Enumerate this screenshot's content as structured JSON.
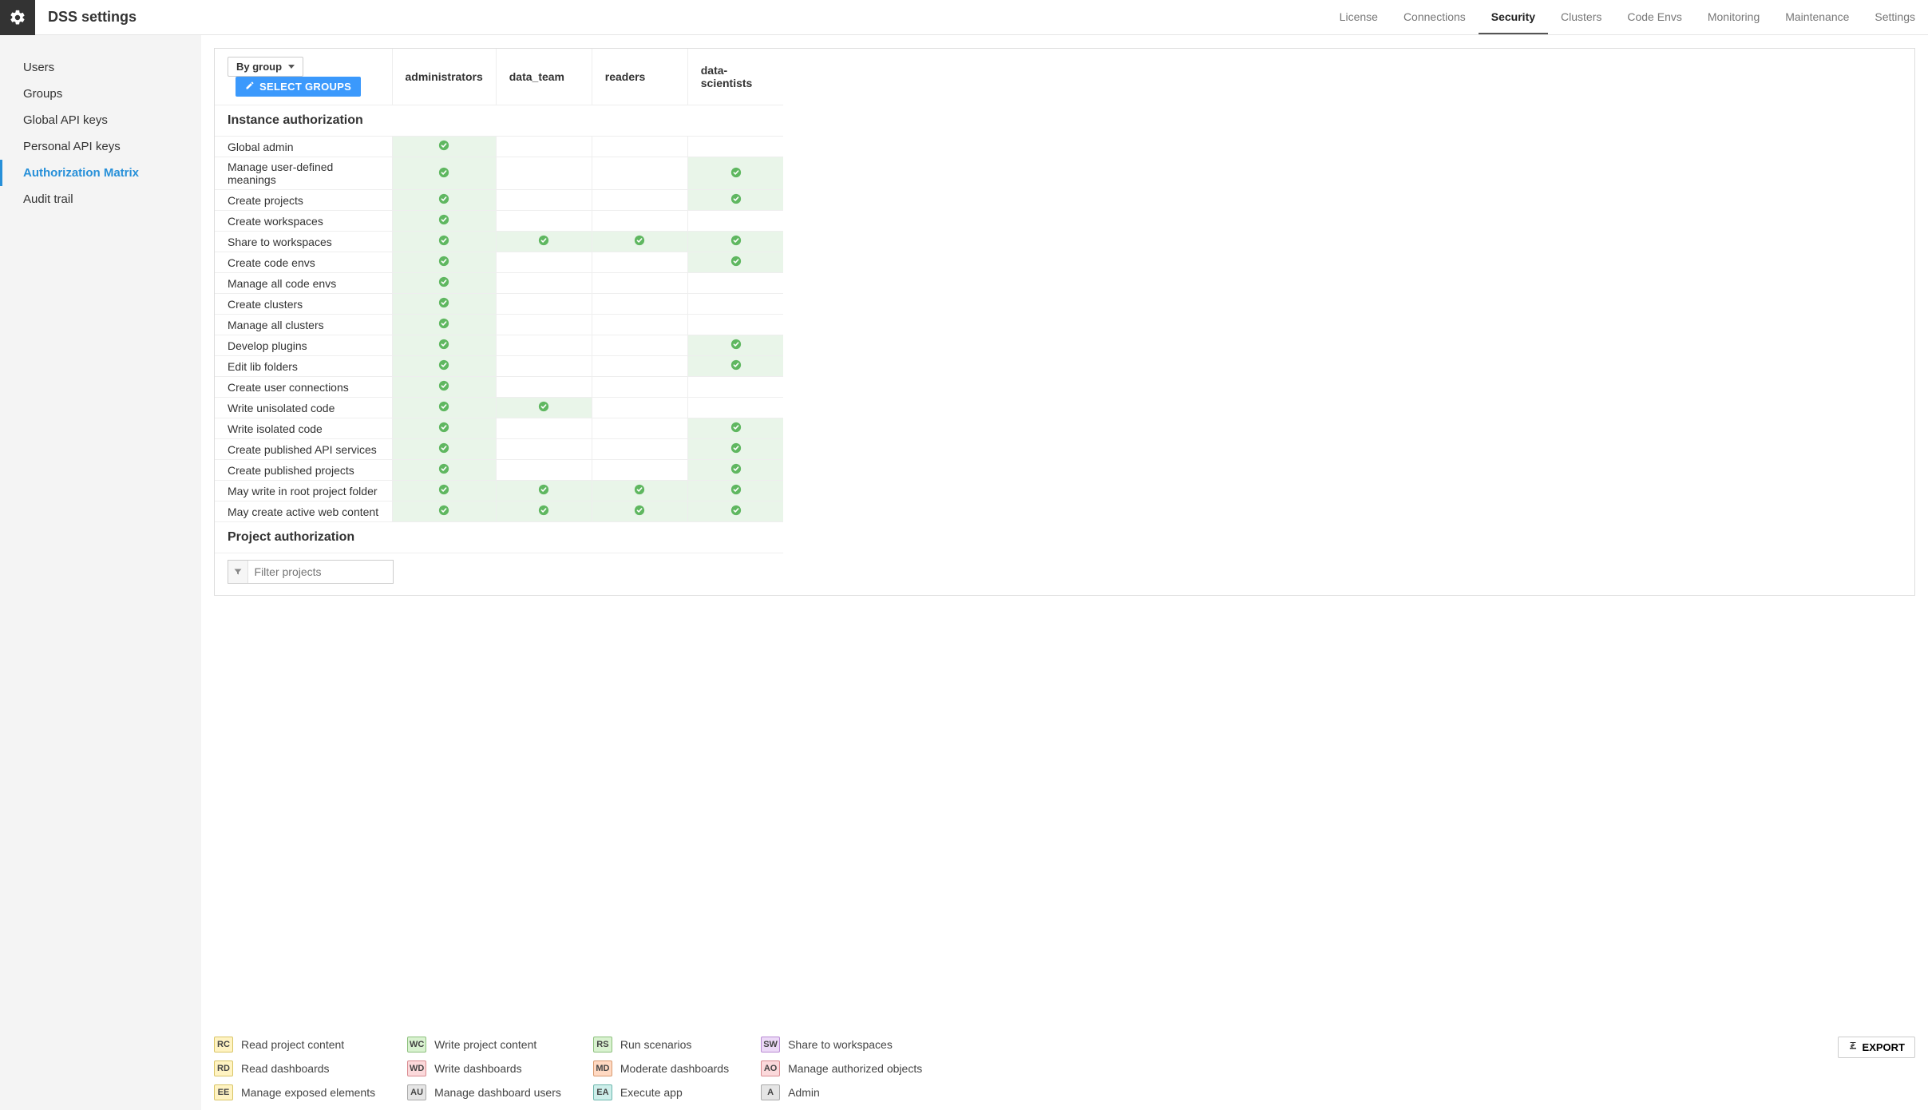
{
  "header": {
    "title": "DSS settings",
    "nav": [
      "License",
      "Connections",
      "Security",
      "Clusters",
      "Code Envs",
      "Monitoring",
      "Maintenance",
      "Settings"
    ],
    "active": "Security"
  },
  "sidebar": {
    "items": [
      "Users",
      "Groups",
      "Global API keys",
      "Personal API keys",
      "Authorization Matrix",
      "Audit trail"
    ],
    "active": "Authorization Matrix"
  },
  "controls": {
    "by_group_label": "By group",
    "select_groups_label": "SELECT GROUPS"
  },
  "groups": [
    "administrators",
    "data_team",
    "readers",
    "data-scientists"
  ],
  "sections": {
    "instance_title": "Instance authorization",
    "project_title": "Project authorization"
  },
  "instance_rows": [
    {
      "label": "Global admin",
      "cells": [
        true,
        false,
        false,
        false
      ]
    },
    {
      "label": "Manage user-defined meanings",
      "cells": [
        true,
        false,
        false,
        true
      ]
    },
    {
      "label": "Create projects",
      "cells": [
        true,
        false,
        false,
        true
      ]
    },
    {
      "label": "Create workspaces",
      "cells": [
        true,
        false,
        false,
        false
      ]
    },
    {
      "label": "Share to workspaces",
      "cells": [
        true,
        true,
        true,
        true
      ]
    },
    {
      "label": "Create code envs",
      "cells": [
        true,
        false,
        false,
        true
      ]
    },
    {
      "label": "Manage all code envs",
      "cells": [
        true,
        false,
        false,
        false
      ]
    },
    {
      "label": "Create clusters",
      "cells": [
        true,
        false,
        false,
        false
      ]
    },
    {
      "label": "Manage all clusters",
      "cells": [
        true,
        false,
        false,
        false
      ]
    },
    {
      "label": "Develop plugins",
      "cells": [
        true,
        false,
        false,
        true
      ]
    },
    {
      "label": "Edit lib folders",
      "cells": [
        true,
        false,
        false,
        true
      ]
    },
    {
      "label": "Create user connections",
      "cells": [
        true,
        false,
        false,
        false
      ]
    },
    {
      "label": "Write unisolated code",
      "cells": [
        true,
        true,
        false,
        false
      ]
    },
    {
      "label": "Write isolated code",
      "cells": [
        true,
        false,
        false,
        true
      ]
    },
    {
      "label": "Create published API services",
      "cells": [
        true,
        false,
        false,
        true
      ]
    },
    {
      "label": "Create published projects",
      "cells": [
        true,
        false,
        false,
        true
      ]
    },
    {
      "label": "May write in root project folder",
      "cells": [
        true,
        true,
        true,
        true
      ]
    },
    {
      "label": "May create active web content",
      "cells": [
        true,
        true,
        true,
        true
      ]
    }
  ],
  "filter": {
    "placeholder": "Filter projects"
  },
  "legend": {
    "cols": [
      [
        {
          "code": "RC",
          "cls": "yellow",
          "label": "Read project content"
        },
        {
          "code": "RD",
          "cls": "yellow",
          "label": "Read dashboards"
        },
        {
          "code": "EE",
          "cls": "yellow",
          "label": "Manage exposed elements"
        }
      ],
      [
        {
          "code": "WC",
          "cls": "green",
          "label": "Write project content"
        },
        {
          "code": "WD",
          "cls": "pink",
          "label": "Write dashboards"
        },
        {
          "code": "AU",
          "cls": "gray",
          "label": "Manage dashboard users"
        }
      ],
      [
        {
          "code": "RS",
          "cls": "green",
          "label": "Run scenarios"
        },
        {
          "code": "MD",
          "cls": "coral",
          "label": "Moderate dashboards"
        },
        {
          "code": "EA",
          "cls": "teal",
          "label": "Execute app"
        }
      ],
      [
        {
          "code": "SW",
          "cls": "purple",
          "label": "Share to workspaces"
        },
        {
          "code": "AO",
          "cls": "pink",
          "label": "Manage authorized objects"
        },
        {
          "code": "A",
          "cls": "gray",
          "label": "Admin"
        }
      ]
    ]
  },
  "export_label": "EXPORT"
}
